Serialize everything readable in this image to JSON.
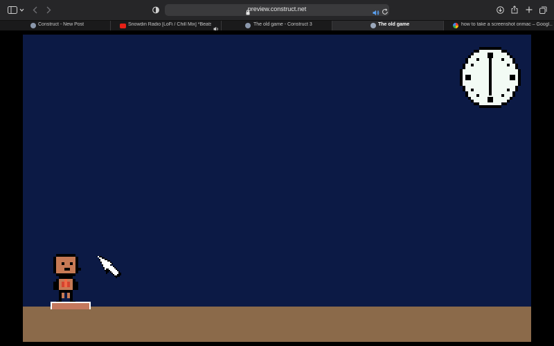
{
  "browser": {
    "url": "preview.construct.net",
    "tabs": [
      {
        "label": "Construct - New Post",
        "active": false
      },
      {
        "label": "Snowdin Radio [LoFi / Chill Mix] *Beats T...",
        "active": false
      },
      {
        "label": "The old game - Construct 3",
        "active": false
      },
      {
        "label": "The old game",
        "active": true
      },
      {
        "label": "how to take a screenshot onmac – Googl...",
        "active": false
      }
    ],
    "icons": [
      "sidebar-icon",
      "back-icon",
      "forward-icon",
      "shield-icon",
      "lock-icon",
      "speaker-icon",
      "reload-icon",
      "download-icon",
      "share-icon",
      "new-tab-icon",
      "tabs-overview-icon"
    ]
  },
  "game": {
    "background_color": "#0c1a45",
    "ground_color": "#8b6a4a",
    "platform_color": "#c4785d",
    "clock_time": "6:00"
  }
}
